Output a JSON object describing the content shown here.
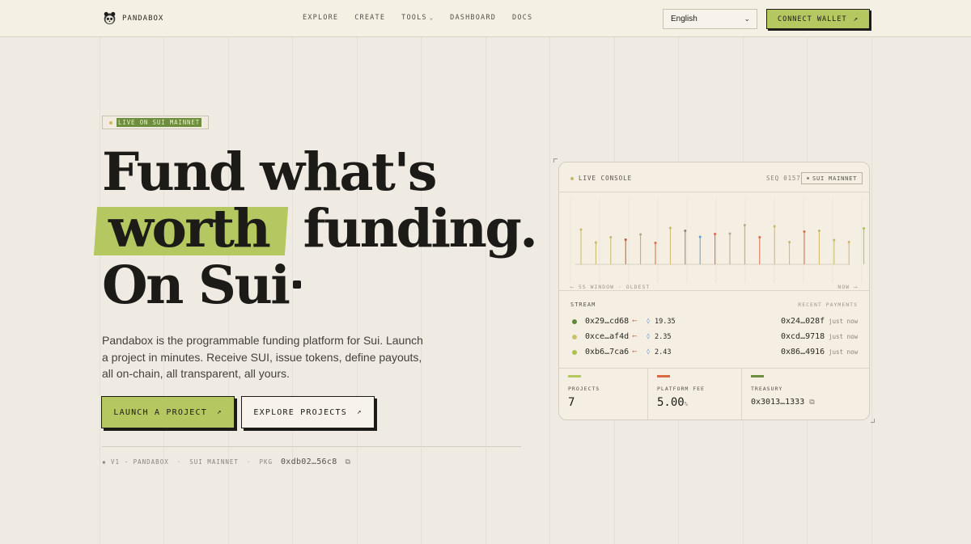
{
  "header": {
    "brand": "PANDABOX",
    "nav": [
      {
        "label": "EXPLORE"
      },
      {
        "label": "CREATE"
      },
      {
        "label": "TOOLS"
      },
      {
        "label": "DASHBOARD"
      },
      {
        "label": "DOCS"
      }
    ],
    "language": "English",
    "connect_label": "CONNECT WALLET"
  },
  "hero": {
    "live_tag": "LIVE ON SUI MAINNET",
    "line1": "Fund what's",
    "line2_highlight": "worth",
    "line2_rest": "funding.",
    "line3": "On Sui",
    "description": "Pandabox is the programmable funding platform for Sui. Launch a project in minutes. Receive SUI, issue tokens, define payouts, all on-chain, all transparent, all yours.",
    "primary_cta": "LAUNCH A PROJECT",
    "secondary_cta": "EXPLORE PROJECTS",
    "meta_version": "V1 · PANDABOX",
    "meta_network": "SUI MAINNET",
    "meta_pkg_label": "PKG",
    "meta_pkg_value": "0xdb02…56c8"
  },
  "console": {
    "title": "LIVE CONSOLE",
    "seq": "SEQ 0157",
    "network_badge": "SUI MAINNET",
    "window_label": "⟵ 5S WINDOW · OLDEST",
    "now_label": "NOW ⟶",
    "stream_label": "STREAM",
    "recent_label": "RECENT PAYMENTS",
    "transactions": [
      {
        "from": "0x29…cd68",
        "amount": "19.35",
        "to": "0x24…028f",
        "time": "just now",
        "dot_color": "#5f8a3a"
      },
      {
        "from": "0xce…af4d",
        "amount": "2.35",
        "to": "0xcd…9718",
        "time": "just now",
        "dot_color": "#c9c26a"
      },
      {
        "from": "0xb6…7ca6",
        "amount": "2.43",
        "to": "0x86…4916",
        "time": "just now",
        "dot_color": "#aec04e"
      }
    ],
    "stats": {
      "projects_label": "PROJECTS",
      "projects_value": "7",
      "fee_label": "PLATFORM FEE",
      "fee_value": "5.00",
      "fee_unit": "%",
      "treasury_label": "TREASURY",
      "treasury_value": "0x3013…1333"
    }
  },
  "colors": {
    "accent": "#b4c760",
    "ink": "#1c1b17",
    "background": "#efebe3",
    "fee_bar": "#d96a45",
    "treasury_bar": "#6d8f3d"
  },
  "chart_data": {
    "type": "bar",
    "xlabel": "5S WINDOW",
    "values": [
      0.86,
      0.54,
      0.67,
      0.61,
      0.74,
      0.53,
      0.9,
      0.83,
      0.68,
      0.75,
      0.76,
      0.97,
      0.67,
      0.94,
      0.55,
      0.81,
      0.83,
      0.6,
      0.55,
      0.89
    ],
    "colors": [
      "#c9b86a",
      "#c9b86a",
      "#c9b86a",
      "#b85c38",
      "#b0a98f",
      "#d96a45",
      "#c9b86a",
      "#8a857a",
      "#6a9ac9",
      "#d96a45",
      "#b0a98f",
      "#b0a98f",
      "#d96a45",
      "#c9b86a",
      "#c9b86a",
      "#d96a45",
      "#c9b86a",
      "#c9b86a",
      "#c9b86a",
      "#aec04e"
    ]
  }
}
